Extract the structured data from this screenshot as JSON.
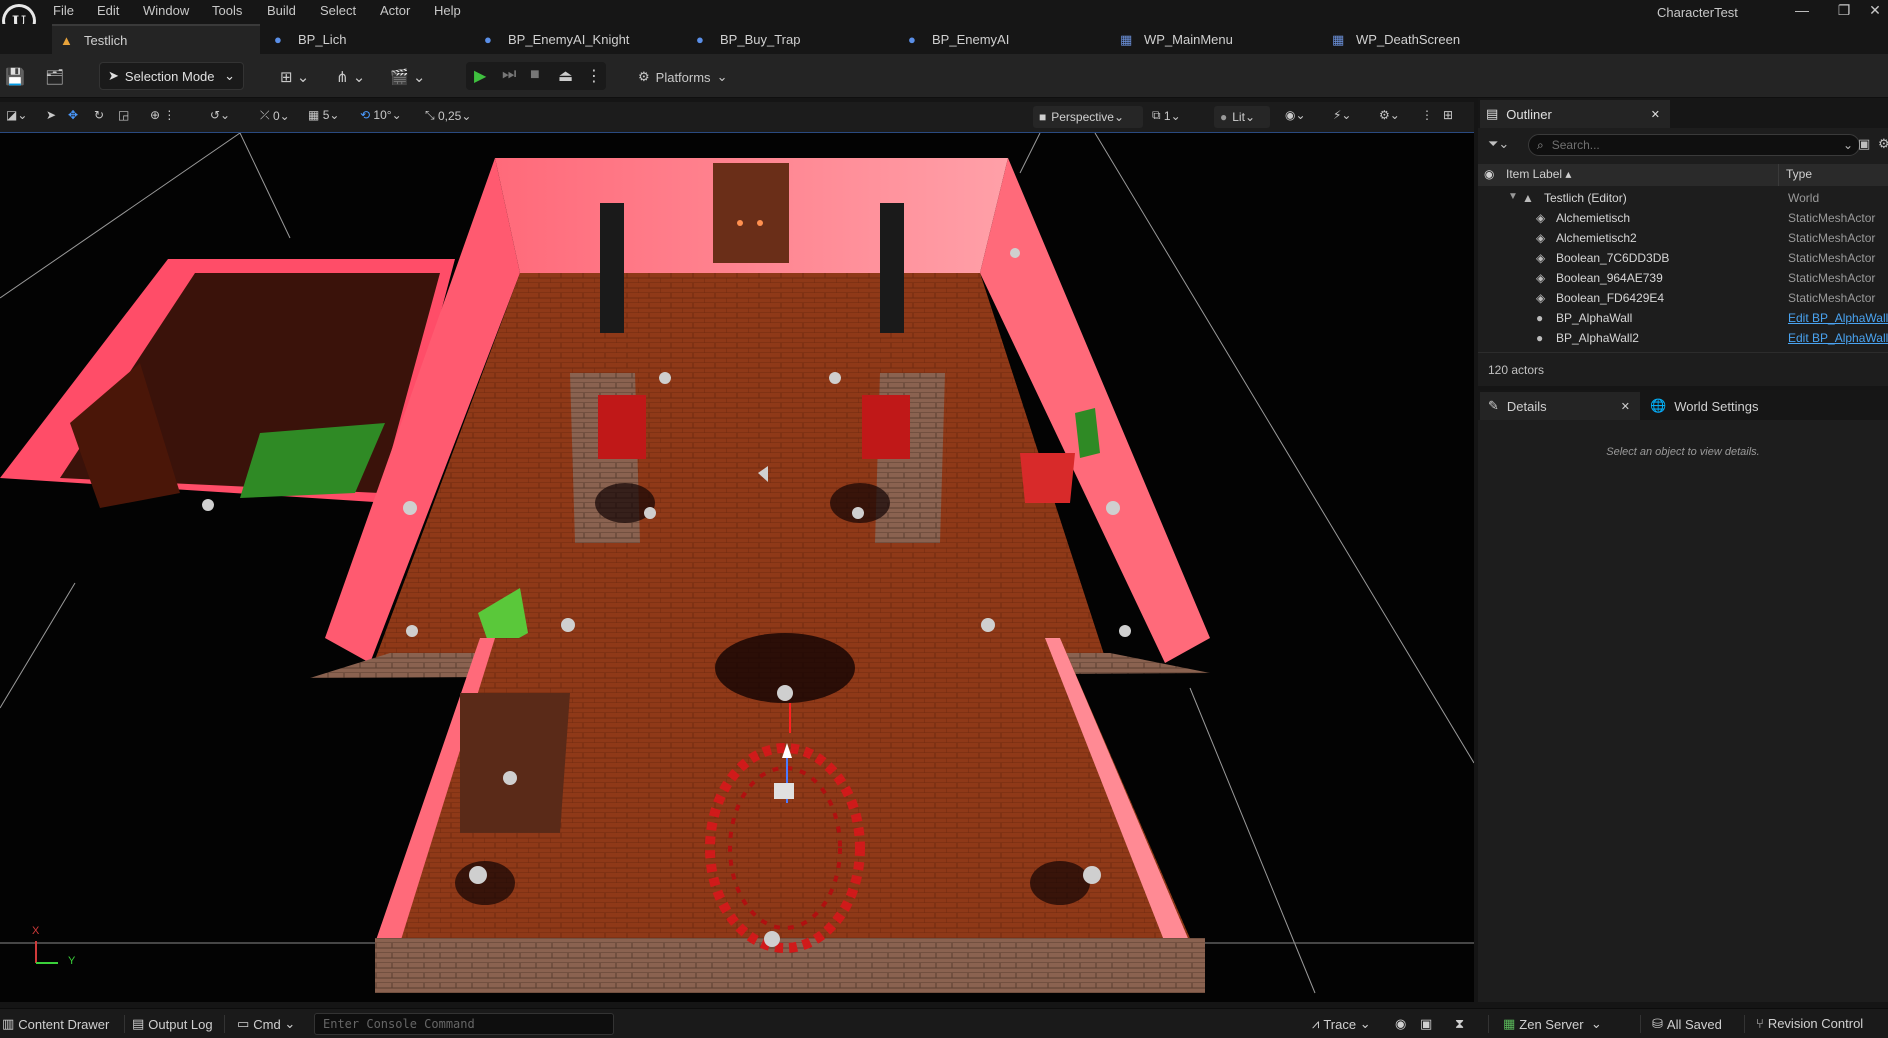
{
  "app": {
    "window_title": "CharacterTest",
    "menu": [
      "File",
      "Edit",
      "Window",
      "Tools",
      "Build",
      "Select",
      "Actor",
      "Help"
    ],
    "window_controls": {
      "minimize": "—",
      "restore": "❐",
      "close": "✕"
    }
  },
  "tabs": [
    {
      "label": "Testlich",
      "icon": "level-icon",
      "active": true
    },
    {
      "label": "BP_Lich",
      "icon": "blueprint-icon"
    },
    {
      "label": "BP_EnemyAI_Knight",
      "icon": "blueprint-icon"
    },
    {
      "label": "BP_Buy_Trap",
      "icon": "blueprint-icon"
    },
    {
      "label": "BP_EnemyAI",
      "icon": "blueprint-icon"
    },
    {
      "label": "WP_MainMenu",
      "icon": "widget-icon"
    },
    {
      "label": "WP_DeathScreen",
      "icon": "widget-icon"
    }
  ],
  "toolbar": {
    "selection_mode": "Selection Mode",
    "platforms": "Platforms"
  },
  "viewport_toolbar": {
    "rotation_snap_label": "0",
    "grid_snap": "5",
    "angle_snap": "10°",
    "scale_snap": "0,25",
    "view_mode": "Perspective",
    "camera_speed": "1",
    "lighting": "Lit"
  },
  "viewport": {
    "axis_x": "X",
    "axis_y": "Y"
  },
  "outliner": {
    "title": "Outliner",
    "search_placeholder": "Search...",
    "col_label": "Item Label",
    "col_type": "Type",
    "items": [
      {
        "label": "Testlich (Editor)",
        "type": "World",
        "icon": "world-icon",
        "indent": 0
      },
      {
        "label": "Alchemietisch",
        "type": "StaticMeshActor",
        "icon": "mesh-icon"
      },
      {
        "label": "Alchemietisch2",
        "type": "StaticMeshActor",
        "icon": "mesh-icon"
      },
      {
        "label": "Boolean_7C6DD3DB",
        "type": "StaticMeshActor",
        "icon": "mesh-icon"
      },
      {
        "label": "Boolean_964AE739",
        "type": "StaticMeshActor",
        "icon": "mesh-icon"
      },
      {
        "label": "Boolean_FD6429E4",
        "type": "StaticMeshActor",
        "icon": "mesh-icon"
      },
      {
        "label": "BP_AlphaWall",
        "type": "Edit BP_AlphaWall",
        "icon": "actor-icon",
        "link": true
      },
      {
        "label": "BP_AlphaWall2",
        "type": "Edit BP_AlphaWall",
        "icon": "actor-icon",
        "link": true
      }
    ],
    "actor_count": "120 actors"
  },
  "details": {
    "tab_details": "Details",
    "tab_world_settings": "World Settings",
    "empty_message": "Select an object to view details."
  },
  "statusbar": {
    "content_drawer": "Content Drawer",
    "output_log": "Output Log",
    "cmd": "Cmd",
    "console_placeholder": "Enter Console Command",
    "trace": "Trace",
    "zen_server": "Zen Server",
    "all_saved": "All Saved",
    "revision_control": "Revision Control"
  }
}
